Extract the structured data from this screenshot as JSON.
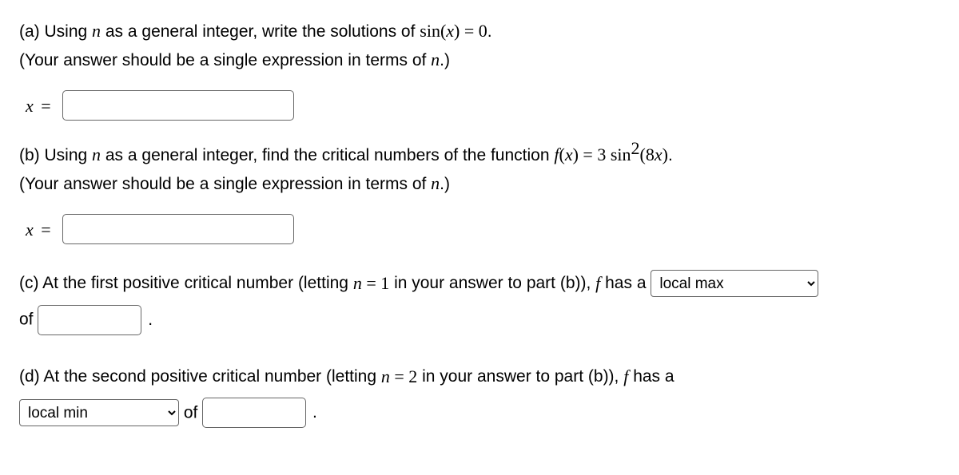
{
  "partA": {
    "line1_pre": "(a) Using ",
    "n": "n",
    "line1_mid": " as a general integer, write the solutions of ",
    "eq_lhs": "sin(",
    "eq_var": "x",
    "eq_rhs": ") = 0",
    "line1_end": ".",
    "line2_pre": "(Your answer should be a single expression in terms of ",
    "line2_end": ".)",
    "x_label": "x",
    "eq_sign": "="
  },
  "partB": {
    "line1_pre": "(b) Using ",
    "n": "n",
    "line1_mid": " as a general integer, find the critical numbers of the function ",
    "f": "f",
    "paren_open": "(",
    "x": "x",
    "paren_close": ")",
    "eq": " = ",
    "rhs_coef": "3 sin",
    "rhs_exp": "2",
    "rhs_arg": "(8",
    "rhs_argvar": "x",
    "rhs_close": ")",
    "line1_end": ".",
    "line2_pre": "(Your answer should be a single expression in terms of ",
    "line2_end": ".)",
    "x_label": "x",
    "eq_sign": "="
  },
  "partC": {
    "pre": "(c) At the first positive critical number (letting ",
    "n": "n",
    "eq": " = ",
    "val": "1",
    "mid": " in your answer to part (b)), ",
    "f": "f",
    "mid2": " has a ",
    "select_value": "local max",
    "of": "of",
    "period": "."
  },
  "partD": {
    "pre": "(d) At the second positive critical number (letting ",
    "n": "n",
    "eq": " = ",
    "val": "2",
    "mid": " in your answer to part (b)), ",
    "f": "f",
    "mid2": " has a",
    "select_value": "local min",
    "of": "of",
    "period": "."
  }
}
